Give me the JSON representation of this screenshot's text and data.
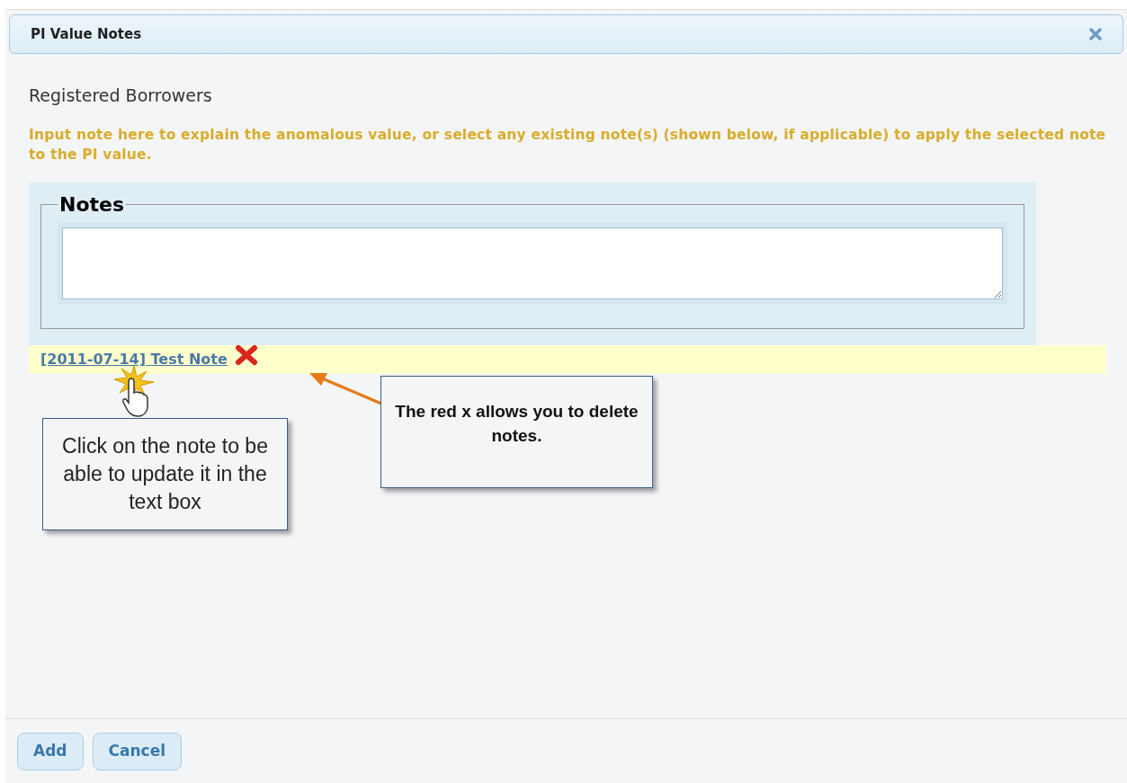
{
  "dialog": {
    "title": "PI Value Notes",
    "subtitle": "Registered Borrowers",
    "instruction": "Input note here to explain the anomalous value, or select any existing note(s) (shown below, if applicable) to apply the selected note to the PI value.",
    "notes_legend": "Notes",
    "existing_notes": [
      {
        "label": "[2011-07-14] Test Note"
      }
    ],
    "buttons": [
      "Add",
      "Cancel"
    ]
  },
  "callouts": [
    {
      "text": "Click on the note to be able to update it in the text box"
    },
    {
      "text": "The red x allows you to delete notes."
    }
  ]
}
